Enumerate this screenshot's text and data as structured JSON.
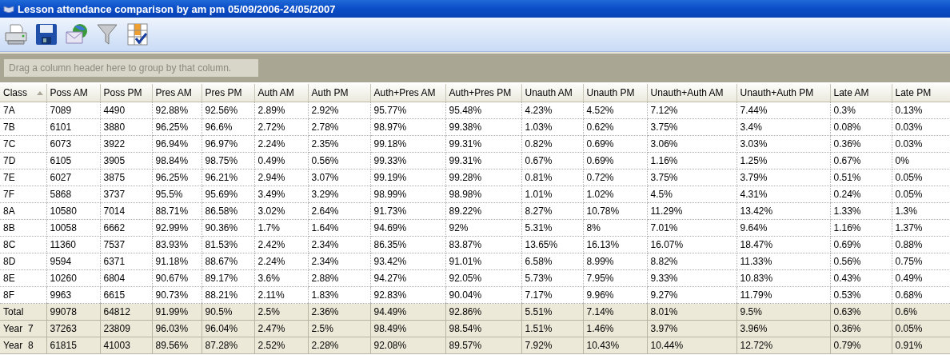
{
  "window": {
    "title": "Lesson attendance comparison by am pm 05/09/2006-24/05/2007"
  },
  "toolbar": {
    "buttons": [
      {
        "kind": "print"
      },
      {
        "kind": "save"
      },
      {
        "kind": "email"
      },
      {
        "kind": "filter"
      },
      {
        "kind": "columns"
      }
    ]
  },
  "group_panel": {
    "placeholder": "Drag a column header here to group by that column."
  },
  "table": {
    "columns": [
      {
        "label": "Class",
        "sorted": true
      },
      {
        "label": "Poss AM",
        "sorted": false
      },
      {
        "label": "Poss PM",
        "sorted": false
      },
      {
        "label": "Pres AM",
        "sorted": false
      },
      {
        "label": "Pres PM",
        "sorted": false
      },
      {
        "label": "Auth AM",
        "sorted": false
      },
      {
        "label": "Auth PM",
        "sorted": false
      },
      {
        "label": "Auth+Pres AM",
        "sorted": false
      },
      {
        "label": "Auth+Pres PM",
        "sorted": false
      },
      {
        "label": "Unauth AM",
        "sorted": false
      },
      {
        "label": "Unauth PM",
        "sorted": false
      },
      {
        "label": "Unauth+Auth AM",
        "sorted": false
      },
      {
        "label": "Unauth+Auth PM",
        "sorted": false
      },
      {
        "label": "Late AM",
        "sorted": false
      },
      {
        "label": "Late PM",
        "sorted": false
      }
    ],
    "rows": [
      {
        "kind": "data",
        "cells": [
          "7A",
          "7089",
          "4490",
          "92.88%",
          "92.56%",
          "2.89%",
          "2.92%",
          "95.77%",
          "95.48%",
          "4.23%",
          "4.52%",
          "7.12%",
          "7.44%",
          "0.3%",
          "0.13%"
        ]
      },
      {
        "kind": "data",
        "cells": [
          "7B",
          "6101",
          "3880",
          "96.25%",
          "96.6%",
          "2.72%",
          "2.78%",
          "98.97%",
          "99.38%",
          "1.03%",
          "0.62%",
          "3.75%",
          "3.4%",
          "0.08%",
          "0.03%"
        ]
      },
      {
        "kind": "data",
        "cells": [
          "7C",
          "6073",
          "3922",
          "96.94%",
          "96.97%",
          "2.24%",
          "2.35%",
          "99.18%",
          "99.31%",
          "0.82%",
          "0.69%",
          "3.06%",
          "3.03%",
          "0.36%",
          "0.03%"
        ]
      },
      {
        "kind": "data",
        "cells": [
          "7D",
          "6105",
          "3905",
          "98.84%",
          "98.75%",
          "0.49%",
          "0.56%",
          "99.33%",
          "99.31%",
          "0.67%",
          "0.69%",
          "1.16%",
          "1.25%",
          "0.67%",
          "0%"
        ]
      },
      {
        "kind": "data",
        "cells": [
          "7E",
          "6027",
          "3875",
          "96.25%",
          "96.21%",
          "2.94%",
          "3.07%",
          "99.19%",
          "99.28%",
          "0.81%",
          "0.72%",
          "3.75%",
          "3.79%",
          "0.51%",
          "0.05%"
        ]
      },
      {
        "kind": "data",
        "cells": [
          "7F",
          "5868",
          "3737",
          "95.5%",
          "95.69%",
          "3.49%",
          "3.29%",
          "98.99%",
          "98.98%",
          "1.01%",
          "1.02%",
          "4.5%",
          "4.31%",
          "0.24%",
          "0.05%"
        ]
      },
      {
        "kind": "data",
        "cells": [
          "8A",
          "10580",
          "7014",
          "88.71%",
          "86.58%",
          "3.02%",
          "2.64%",
          "91.73%",
          "89.22%",
          "8.27%",
          "10.78%",
          "11.29%",
          "13.42%",
          "1.33%",
          "1.3%"
        ]
      },
      {
        "kind": "data",
        "cells": [
          "8B",
          "10058",
          "6662",
          "92.99%",
          "90.36%",
          "1.7%",
          "1.64%",
          "94.69%",
          "92%",
          "5.31%",
          "8%",
          "7.01%",
          "9.64%",
          "1.16%",
          "1.37%"
        ]
      },
      {
        "kind": "data",
        "cells": [
          "8C",
          "11360",
          "7537",
          "83.93%",
          "81.53%",
          "2.42%",
          "2.34%",
          "86.35%",
          "83.87%",
          "13.65%",
          "16.13%",
          "16.07%",
          "18.47%",
          "0.69%",
          "0.88%"
        ]
      },
      {
        "kind": "data",
        "cells": [
          "8D",
          "9594",
          "6371",
          "91.18%",
          "88.67%",
          "2.24%",
          "2.34%",
          "93.42%",
          "91.01%",
          "6.58%",
          "8.99%",
          "8.82%",
          "11.33%",
          "0.56%",
          "0.75%"
        ]
      },
      {
        "kind": "data",
        "cells": [
          "8E",
          "10260",
          "6804",
          "90.67%",
          "89.17%",
          "3.6%",
          "2.88%",
          "94.27%",
          "92.05%",
          "5.73%",
          "7.95%",
          "9.33%",
          "10.83%",
          "0.43%",
          "0.49%"
        ]
      },
      {
        "kind": "data",
        "cells": [
          "8F",
          "9963",
          "6615",
          "90.73%",
          "88.21%",
          "2.11%",
          "1.83%",
          "92.83%",
          "90.04%",
          "7.17%",
          "9.96%",
          "9.27%",
          "11.79%",
          "0.53%",
          "0.68%"
        ]
      },
      {
        "kind": "summary",
        "cells": [
          "Total",
          "99078",
          "64812",
          "91.99%",
          "90.5%",
          "2.5%",
          "2.36%",
          "94.49%",
          "92.86%",
          "5.51%",
          "7.14%",
          "8.01%",
          "9.5%",
          "0.63%",
          "0.6%"
        ]
      },
      {
        "kind": "summary",
        "cells": [
          "Year  7",
          "37263",
          "23809",
          "96.03%",
          "96.04%",
          "2.47%",
          "2.5%",
          "98.49%",
          "98.54%",
          "1.51%",
          "1.46%",
          "3.97%",
          "3.96%",
          "0.36%",
          "0.05%"
        ]
      },
      {
        "kind": "summary",
        "cells": [
          "Year  8",
          "61815",
          "41003",
          "89.56%",
          "87.28%",
          "2.52%",
          "2.28%",
          "92.08%",
          "89.57%",
          "7.92%",
          "10.43%",
          "10.44%",
          "12.72%",
          "0.79%",
          "0.91%"
        ]
      }
    ]
  }
}
